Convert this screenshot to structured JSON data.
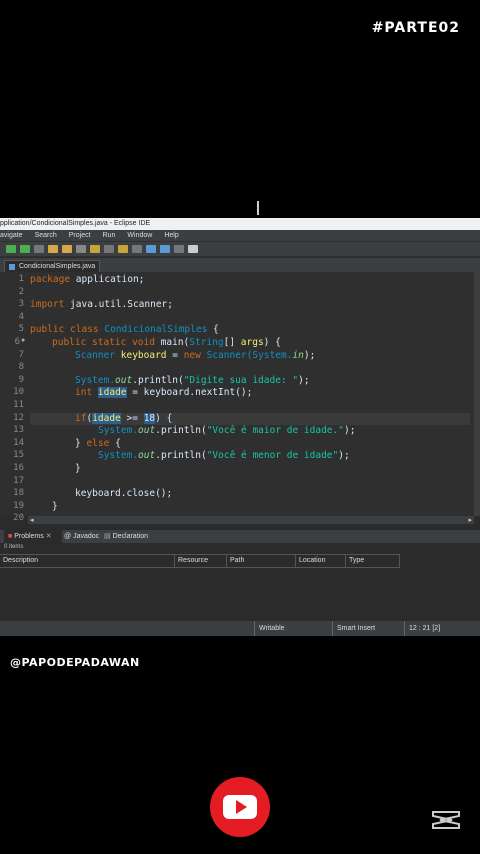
{
  "overlay": {
    "part_tag": "#PARTE02",
    "handle": "@PAPODEPADAWAN"
  },
  "window": {
    "title": "pplication/CondicionalSimples.java - Eclipse IDE"
  },
  "menu": [
    "avigate",
    "Search",
    "Project",
    "Run",
    "Window",
    "Help"
  ],
  "editor_tab": {
    "label": "CondicionalSimples.java",
    "close": "✕"
  },
  "gutter": {
    "line6_marker": "●"
  },
  "code": {
    "line_numbers": [
      "1",
      "2",
      "3",
      "4",
      "5",
      "6",
      "7",
      "8",
      "9",
      "10",
      "11",
      "12",
      "13",
      "14",
      "15",
      "16",
      "17",
      "18",
      "19",
      "20"
    ],
    "l1_kw": "package",
    "l1_rest": " application;",
    "l3_kw": "import",
    "l3_rest": " java.util.Scanner;",
    "l5_kw": "public class",
    "l5_cls": " CondicionalSimples",
    "l5_rest": " {",
    "l6_kw": "public static void",
    "l6_a": " main(",
    "l6_cls": "String",
    "l6_b": "[] ",
    "l6_var": "args",
    "l6_c": ") {",
    "l7_cls": "Scanner",
    "l7_var": " keyboard",
    "l7_a": " = ",
    "l7_kw": "new",
    "l7_cls2": " Scanner(",
    "l7_cls3": "System.",
    "l7_fld": "in",
    "l7_b": ");",
    "l9_cls": "System.",
    "l9_fld": "out",
    "l9_a": ".println(",
    "l9_str": "\"Digite sua idade: \"",
    "l9_b": ");",
    "l10_kw": "int",
    "l10_var": "idade",
    "l10_a": " = keyboard.nextInt();",
    "l12_kw": "if",
    "l12_a": "(",
    "l12_var": "idade",
    "l12_b": " >= ",
    "l12_num": "18",
    "l12_c": ") {",
    "l13_cls": "System.",
    "l13_fld": "out",
    "l13_a": ".println(",
    "l13_str": "\"Você é maior de idade.\"",
    "l13_b": ");",
    "l14_a": "} ",
    "l14_kw": "else",
    "l14_b": " {",
    "l15_cls": "System.",
    "l15_fld": "out",
    "l15_a": ".println(",
    "l15_str": "\"Você é menor de idade\"",
    "l15_b": ");",
    "l16": "}",
    "l18": "keyboard.close();",
    "l19": "}"
  },
  "panel": {
    "tabs": {
      "problems": "Problems",
      "close": "✕",
      "javadoc": "Javadoc",
      "declaration": "Declaration"
    },
    "items": "0 items",
    "columns": [
      "Description",
      "Resource",
      "Path",
      "Location",
      "Type"
    ]
  },
  "status": {
    "writable": "Writable",
    "insert": "Smart Insert",
    "position": "12 : 21 [2]"
  },
  "colors": {
    "youtube_red": "#e41c23",
    "editor_bg": "#2f2f2f"
  }
}
